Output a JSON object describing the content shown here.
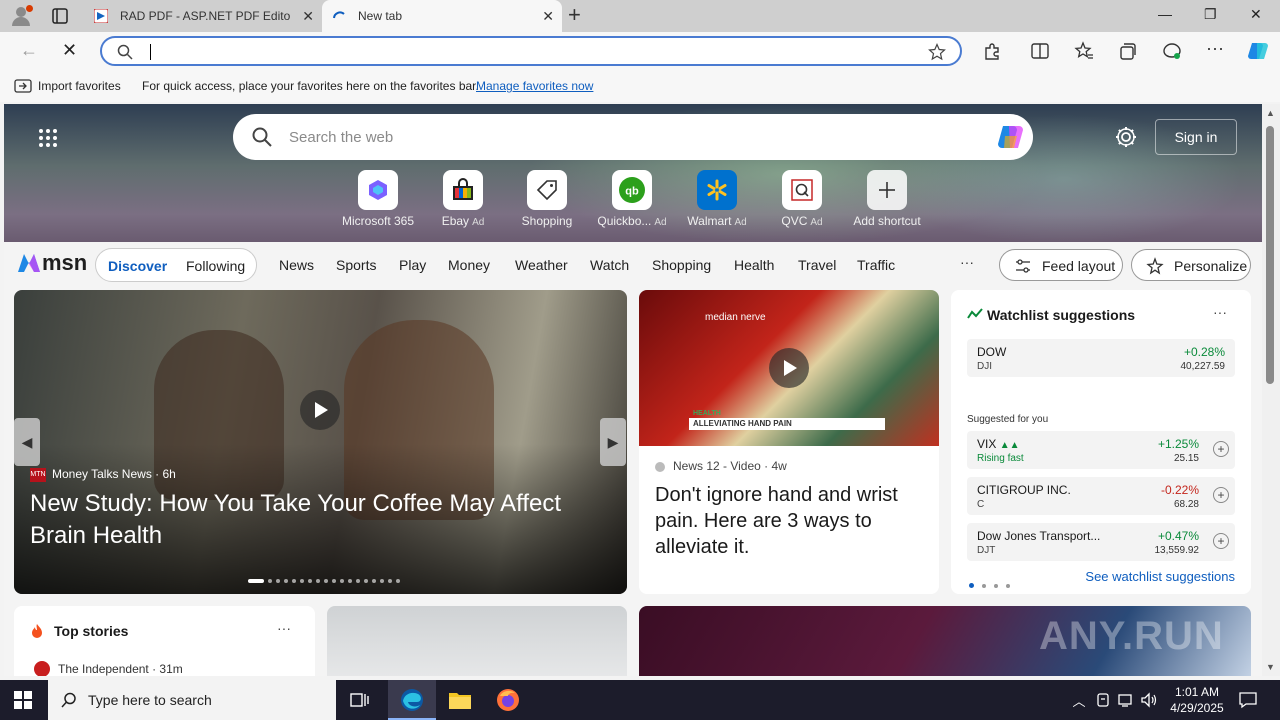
{
  "browser": {
    "tabs": [
      {
        "label": "RAD PDF - ASP.NET PDF Editor ar",
        "active": false
      },
      {
        "label": "New tab",
        "active": true
      }
    ],
    "address_value": "",
    "favbar": {
      "import_label": "Import favorites",
      "message": "For quick access, place your favorites here on the favorites bar.",
      "link": "Manage favorites now"
    }
  },
  "newtab": {
    "search_placeholder": "Search the web",
    "signin_label": "Sign in",
    "shortcuts": [
      {
        "label": "Microsoft 365",
        "ad": ""
      },
      {
        "label": "Ebay",
        "ad": "Ad"
      },
      {
        "label": "Shopping",
        "ad": ""
      },
      {
        "label": "Quickbo...",
        "ad": "Ad"
      },
      {
        "label": "Walmart",
        "ad": "Ad"
      },
      {
        "label": "QVC",
        "ad": "Ad"
      },
      {
        "label": "Add shortcut",
        "ad": ""
      }
    ]
  },
  "msn": {
    "logo": "msn",
    "pill": {
      "discover": "Discover",
      "following": "Following"
    },
    "nav": [
      "News",
      "Sports",
      "Play",
      "Money",
      "Weather",
      "Watch",
      "Shopping",
      "Health",
      "Travel",
      "Traffic"
    ],
    "more": "···",
    "feed_layout": "Feed layout",
    "personalize": "Personalize"
  },
  "feature": {
    "source": "Money Talks News",
    "time": "6h",
    "source_logo": "MTN",
    "headline": "New Study: How You Take Your Coffee May Affect Brain Health"
  },
  "video": {
    "overlay_label": "median nerve",
    "caption_tag": "HEALTH",
    "caption": "ALLEVIATING HAND PAIN",
    "source": "News 12 - Video",
    "time": "4w",
    "title": "Don't ignore hand and wrist pain. Here are 3 ways to alleviate it."
  },
  "watchlist": {
    "title": "Watchlist suggestions",
    "suggested_label": "Suggested for you",
    "see_link": "See watchlist suggestions",
    "primary": {
      "name": "DOW",
      "sub": "DJI",
      "pct": "+0.28%",
      "value": "40,227.59"
    },
    "items": [
      {
        "name": "VIX",
        "sub": "Rising fast",
        "pct": "+1.25%",
        "value": "25.15"
      },
      {
        "name": "CITIGROUP INC.",
        "sub": "C",
        "pct": "-0.22%",
        "value": "68.28"
      },
      {
        "name": "Dow Jones Transport...",
        "sub": "DJT",
        "pct": "+0.47%",
        "value": "13,559.92"
      }
    ],
    "colors": {
      "up": "#0a8a3a",
      "down": "#c4261d"
    }
  },
  "topstories": {
    "title": "Top stories",
    "source": "The Independent · 31m"
  },
  "watermark": "ANY.RUN",
  "taskbar": {
    "search_placeholder": "Type here to search",
    "time": "1:01 AM",
    "date": "4/29/2025"
  }
}
